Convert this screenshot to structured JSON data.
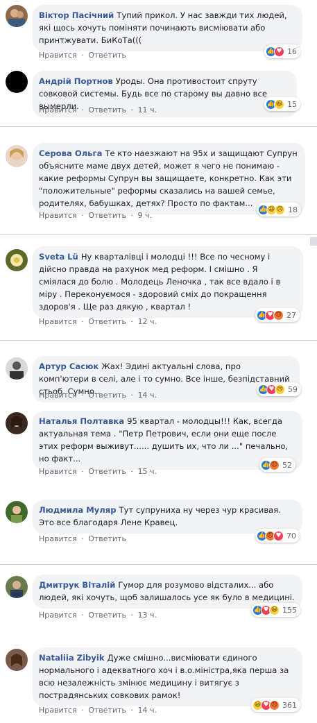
{
  "actions": {
    "like": "Нравится",
    "reply": "Ответить",
    "dot": "·"
  },
  "colors": {
    "author": "#385898",
    "bubble": "#f2f3f5",
    "muted": "#606770",
    "like": "#1877f2",
    "love": "#f33e58",
    "haha": "#fbcf3f",
    "angry": "#f27933"
  },
  "comments": [
    {
      "author": "Віктор Пасічний",
      "text": "Тупий прикол. У нас завжди тих людей, які щось хочуть поміняти починають висміювати або принтжувати. БиКоТа(((",
      "time": "",
      "reactions": [
        "like",
        "love"
      ],
      "reaction_count": "16"
    },
    {
      "author": "Андрій Портнов",
      "text": "Уроды. Она противостоит спруту совковой системы. Будь все по старому вы давно все вымерли.",
      "time": "11 ч.",
      "reactions": [
        "like",
        "haha"
      ],
      "reaction_count": "15"
    },
    {
      "author": "Серова Ольга",
      "text": "Те кто наезжают на 95х и защищают Супрун объясните маме двух детей, может я чего не понимаю - какие реформы Супрун вы защищаете, конкретно. Как эти \"положительные\" реформы сказались на вашей семье, родителях, бабушках, детях? Просто по фактам...",
      "time": "9 ч.",
      "reactions": [
        "like",
        "haha",
        "sad"
      ],
      "reaction_count": "18"
    },
    {
      "author": "Sveta Lü",
      "text": "Ну кварталівці і молодці !!! Все по чесному і дійсно правда на рахунок мед реформ. І смішно . Я сміялася до болю . Молодець Леночка , так все вдало і в міру . Переконуємося - здоровий сміх до покращення здоров'я . Ще раз дякую , квартал !",
      "time": "12 ч.",
      "reactions": [
        "like",
        "love",
        "angry"
      ],
      "reaction_count": "27"
    },
    {
      "author": "Артур Сасюк",
      "text": "Жах! Эдині актуальні слова, про комп'ютери в селі, але і то сумно. Все інше, безпідставний стьоб. Сумно..",
      "time": "14 ч.",
      "reactions": [
        "like",
        "love",
        "sad"
      ],
      "reaction_count": "59"
    },
    {
      "author": "Наталья Полтавка",
      "text": "95 квартал - молодцы!!! Как, всегда актуальная тема . \"Петр Петрович, если они еще после этих реформ выживут...... душить их, что ли ...\" печально, но факт...",
      "time": "15 ч.",
      "reactions": [
        "like",
        "angry"
      ],
      "reaction_count": "52"
    },
    {
      "author": "Людмила Муляр",
      "text": "Тут супруниха ну через чур красивая. Это все благодаря Лене Кравец.",
      "time": "",
      "reactions": [
        "like",
        "angry",
        "love"
      ],
      "reaction_count": "70"
    },
    {
      "author": "Дмитрук Віталій",
      "text": "Гумор для розумово відсталих... або людей, які хочуть, щоб залишалось усе як було в медицині.",
      "time": "13 ч.",
      "reactions": [
        "like",
        "love",
        "haha"
      ],
      "reaction_count": "155"
    },
    {
      "author": "Nataliia Zibyik",
      "text": "Дуже смішно...висміювати єдиного нормального і адекватного хоч і в.о.міністра,яка перша за всю незалежність змінює медицину і витягує з пострадянських совкових рамок!",
      "time": "14 ч.",
      "reactions": [
        "haha",
        "love",
        "angry"
      ],
      "reaction_count": "361"
    }
  ]
}
